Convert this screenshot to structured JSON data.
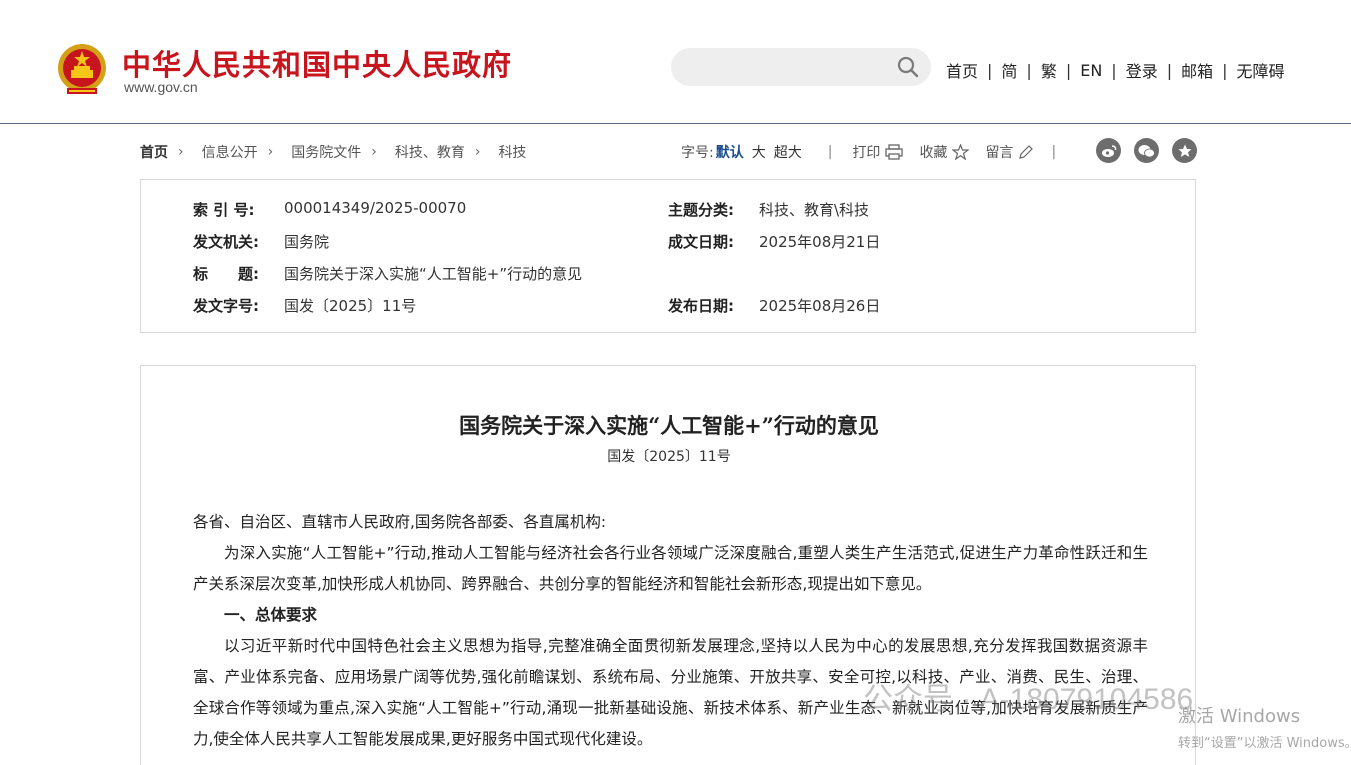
{
  "header": {
    "site_title": "中华人民共和国中央人民政府",
    "site_domain": "www.gov.cn",
    "search_placeholder": "",
    "nav": [
      "首页",
      "简",
      "繁",
      "EN",
      "登录",
      "邮箱",
      "无障碍"
    ],
    "nav_separator": "|"
  },
  "breadcrumb": {
    "items": [
      "首页",
      "信息公开",
      "国务院文件",
      "科技、教育",
      "科技"
    ],
    "arrow": "›"
  },
  "tools": {
    "font_label": "字号:",
    "font_default": "默认",
    "font_large": "大",
    "font_xlarge": "超大",
    "divider": "|",
    "print": "打印",
    "favorite": "收藏",
    "comment": "留言",
    "share_icons": [
      "weibo-icon",
      "wechat-icon",
      "qzone-icon"
    ]
  },
  "meta": {
    "index_label": "索 引 号:",
    "index_value": "000014349/2025-00070",
    "topic_label": "主题分类:",
    "topic_value": "科技、教育\\科技",
    "issuer_label": "发文机关:",
    "issuer_value": "国务院",
    "written_label": "成文日期:",
    "written_value": "2025年08月21日",
    "title_label": "标　　题:",
    "title_value": "国务院关于深入实施“人工智能+”行动的意见",
    "docno_label": "发文字号:",
    "docno_value": "国发〔2025〕11号",
    "published_label": "发布日期:",
    "published_value": "2025年08月26日"
  },
  "article": {
    "title": "国务院关于深入实施“人工智能+”行动的意见",
    "docno": "国发〔2025〕11号",
    "salutation": "各省、自治区、直辖市人民政府,国务院各部委、各直属机构:",
    "para1": "为深入实施“人工智能+”行动,推动人工智能与经济社会各行业各领域广泛深度融合,重塑人类生产生活范式,促进生产力革命性跃迁和生产关系深层次变革,加快形成人机协同、跨界融合、共创分享的智能经济和智能社会新形态,现提出如下意见。",
    "heading1": "一、总体要求",
    "para2": "以习近平新时代中国特色社会主义思想为指导,完整准确全面贯彻新发展理念,坚持以人民为中心的发展思想,充分发挥我国数据资源丰富、产业体系完备、应用场景广阔等优势,强化前瞻谋划、系统布局、分业施策、开放共享、安全可控,以科技、产业、消费、民生、治理、全球合作等领域为重点,深入实施“人工智能+”行动,涌现一批新基础设施、新技术体系、新产业生态、新就业岗位等,加快培育发展新质生产力,使全体人民共享人工智能发展成果,更好服务中国式现代化建设。"
  },
  "overlay": {
    "watermark": "公众号 · A-18079104586",
    "activate_title": "激活 Windows",
    "activate_sub": "转到“设置”以激活 Windows。"
  },
  "colors": {
    "brand_red": "#c8141c",
    "link_blue": "#1c4d8c"
  }
}
